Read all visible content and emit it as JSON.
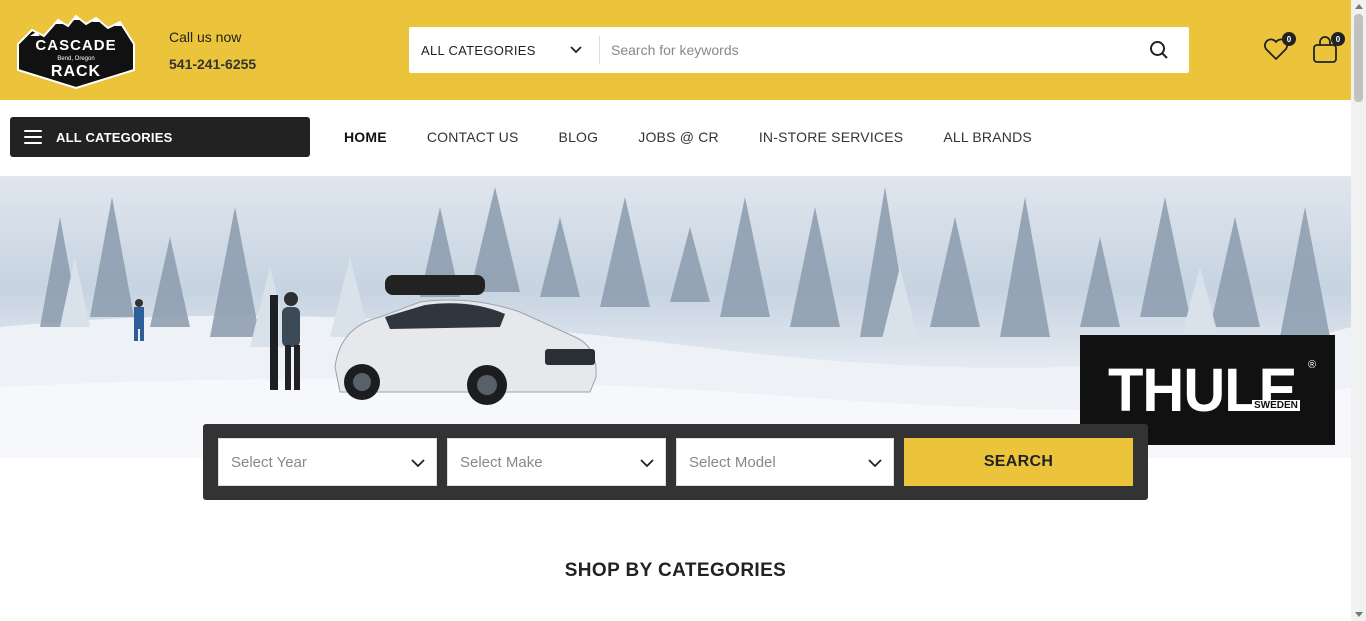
{
  "header": {
    "logo": {
      "line1": "CASCADE",
      "line2": "Bend, Oregon",
      "line3": "RACK"
    },
    "call_label": "Call us now",
    "phone": "541-241-6255",
    "search": {
      "category_value": "ALL CATEGORIES",
      "placeholder": "Search for keywords"
    },
    "wishlist_count": "0",
    "cart_count": "0"
  },
  "nav": {
    "all_categories_label": "ALL CATEGORIES",
    "menu": [
      {
        "label": "HOME",
        "active": true
      },
      {
        "label": "CONTACT US"
      },
      {
        "label": "BLOG"
      },
      {
        "label": "JOBS @ CR"
      },
      {
        "label": "IN-STORE SERVICES"
      },
      {
        "label": "ALL BRANDS"
      }
    ]
  },
  "hero": {
    "brand_word": "THULE",
    "brand_sub": "SWEDEN",
    "brand_reg": "®"
  },
  "vehicle_search": {
    "year_placeholder": "Select Year",
    "make_placeholder": "Select Make",
    "model_placeholder": "Select Model",
    "button_label": "SEARCH"
  },
  "sections": {
    "shop_by_categories": "SHOP BY CATEGORIES"
  },
  "colors": {
    "accent": "#ebc43b",
    "dark": "#222222",
    "panel": "#333333"
  }
}
